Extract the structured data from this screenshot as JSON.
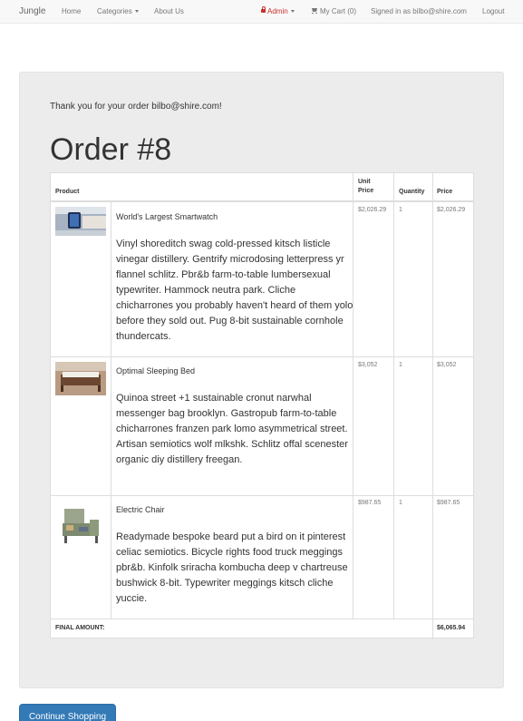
{
  "navbar": {
    "brand": "Jungle",
    "home": "Home",
    "categories": "Categories",
    "about": "About Us",
    "admin": "Admin",
    "cart": "My Cart (0)",
    "signed_in": "Signed in as bilbo@shire.com",
    "logout": "Logout"
  },
  "order": {
    "thanks": "Thank you for your order bilbo@shire.com!",
    "title": "Order #8",
    "headers": {
      "product": "Product",
      "unit_price_1": "Unit",
      "unit_price_2": "Price",
      "quantity": "Quantity",
      "price": "Price"
    },
    "items": [
      {
        "name": "World's Largest Smartwatch",
        "description": "Vinyl shoreditch swag cold-pressed kitsch listicle vinegar distillery. Gentrify microdosing letterpress yr flannel schlitz. Pbr&b farm-to-table lumbersexual typewriter. Hammock neutra park. Cliche chicharrones you probably haven't heard of them yolo before they sold out. Pug 8-bit sustainable cornhole thundercats.",
        "unit_price": "$2,026.29",
        "quantity": "1",
        "price": "$2,026.29",
        "image_icon": "smartwatch-image"
      },
      {
        "name": "Optimal Sleeping Bed",
        "description": "Quinoa street +1 sustainable cronut narwhal messenger bag brooklyn. Gastropub farm-to-table chicharrones franzen park lomo asymmetrical street. Artisan semiotics wolf mlkshk. Schlitz offal scenester organic diy distillery freegan.",
        "unit_price": "$3,052",
        "quantity": "1",
        "price": "$3,052",
        "image_icon": "bed-image"
      },
      {
        "name": "Electric Chair",
        "description": "Readymade bespoke beard put a bird on it pinterest celiac semiotics. Bicycle rights food truck meggings pbr&b. Kinfolk sriracha kombucha deep v chartreuse bushwick 8-bit. Typewriter meggings kitsch cliche yuccie.",
        "unit_price": "$987.65",
        "quantity": "1",
        "price": "$987.65",
        "image_icon": "chair-image"
      }
    ],
    "final_label": "FINAL AMOUNT:",
    "final_amount": "$6,065.94"
  },
  "actions": {
    "continue": "Continue Shopping"
  },
  "colors": {
    "primary": "#337ab7",
    "admin": "#c9302c",
    "well": "#ececec"
  }
}
